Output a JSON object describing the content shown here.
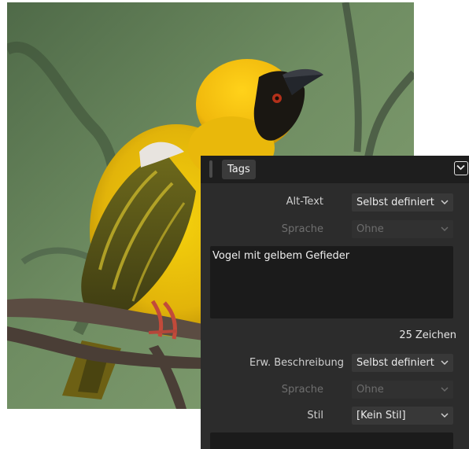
{
  "panel": {
    "tab_label": "Tags",
    "alt_text": {
      "label": "Alt-Text",
      "value": "Selbst definiert"
    },
    "alt_language": {
      "label": "Sprache",
      "value": "Ohne"
    },
    "alt_text_value": "Vogel mit gelbem Gefieder",
    "char_count": "25",
    "char_unit": "Zeichen",
    "ext_description": {
      "label": "Erw. Beschreibung",
      "value": "Selbst definiert"
    },
    "ext_language": {
      "label": "Sprache",
      "value": "Ohne"
    },
    "style": {
      "label": "Stil",
      "value": "[Kein Stil]"
    }
  },
  "colors": {
    "panel_bg": "#2c2c2c",
    "header_bg": "#1e1e1e",
    "field_bg": "#1b1b1b"
  }
}
